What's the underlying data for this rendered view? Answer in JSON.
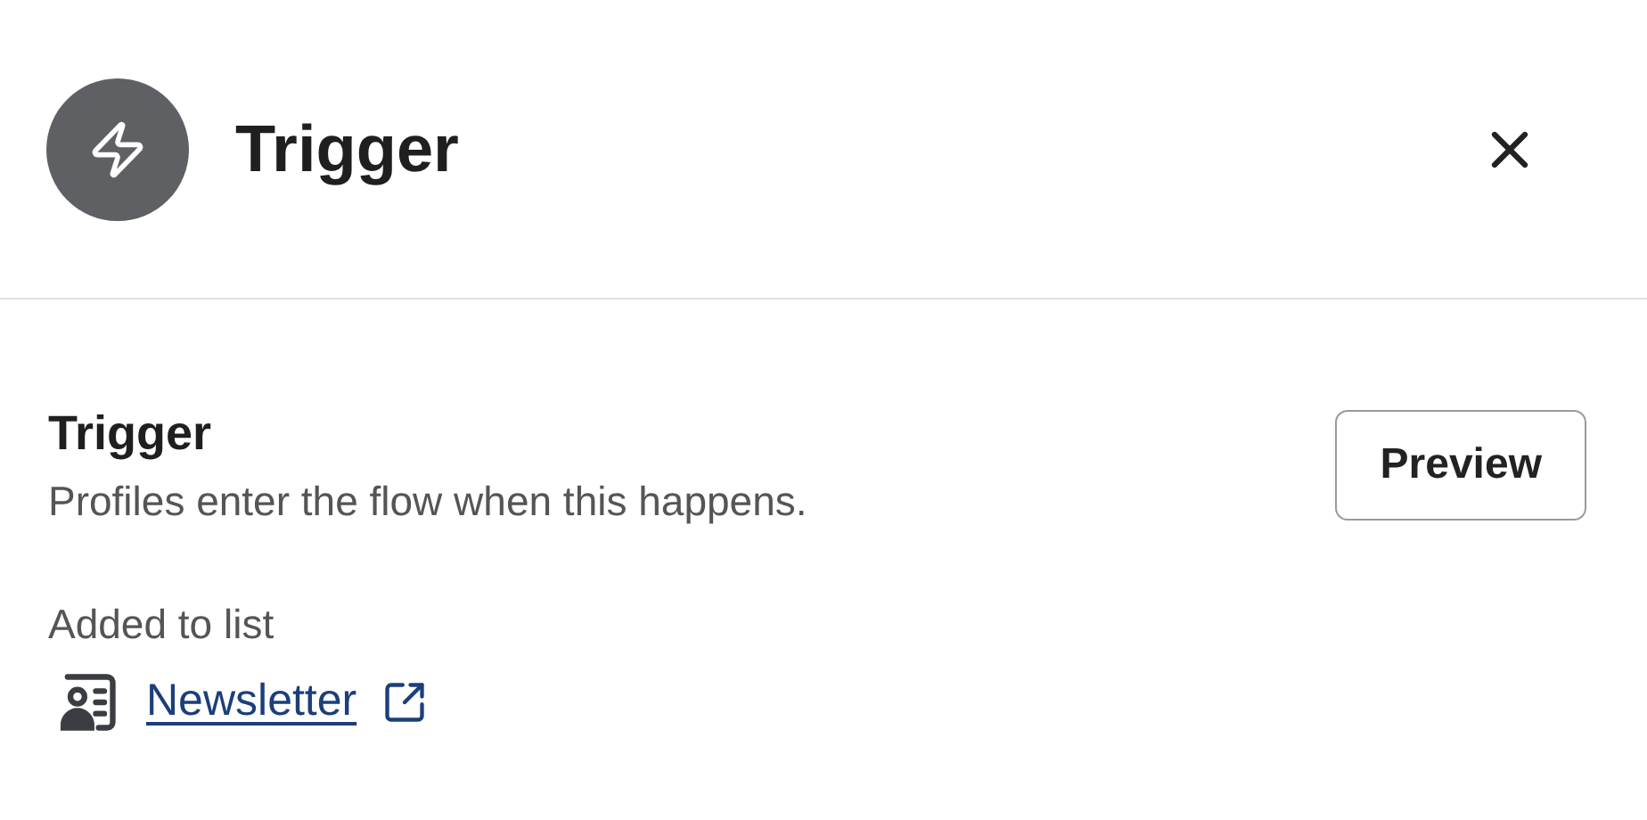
{
  "header": {
    "title": "Trigger"
  },
  "section": {
    "title": "Trigger",
    "description": "Profiles enter the flow when this happens.",
    "preview_button": "Preview"
  },
  "trigger_detail": {
    "label": "Added to list",
    "list_link": "Newsletter"
  }
}
